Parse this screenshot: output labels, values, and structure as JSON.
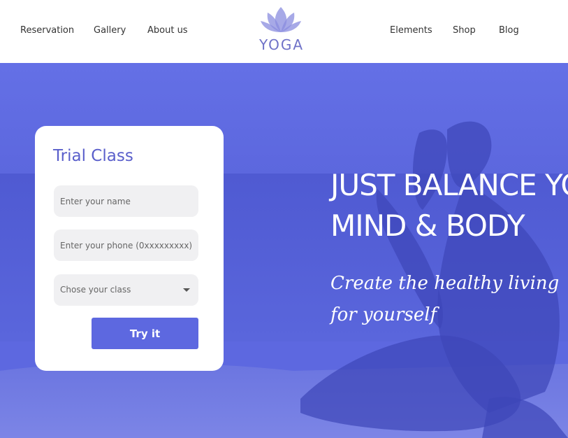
{
  "nav": {
    "left": [
      "Reservation",
      "Gallery",
      "About us"
    ],
    "right": [
      "Elements",
      "Shop",
      "Blog"
    ]
  },
  "logo": {
    "text": "YOGA",
    "icon": "lotus-icon"
  },
  "trial": {
    "title": "Trial Class",
    "name_placeholder": "Enter your name",
    "phone_placeholder": "Enter your phone (0xxxxxxxxx)",
    "class_placeholder": "Chose your class",
    "button": "Try it"
  },
  "hero": {
    "headline_line1": "JUST BALANCE YOUR",
    "headline_line2": "MIND & BODY",
    "tagline_line1": "Create the healthy living",
    "tagline_line2": "for yourself"
  },
  "colors": {
    "accent": "#5d68e0",
    "logo": "#6f72c8",
    "title": "#5a5fcb"
  }
}
